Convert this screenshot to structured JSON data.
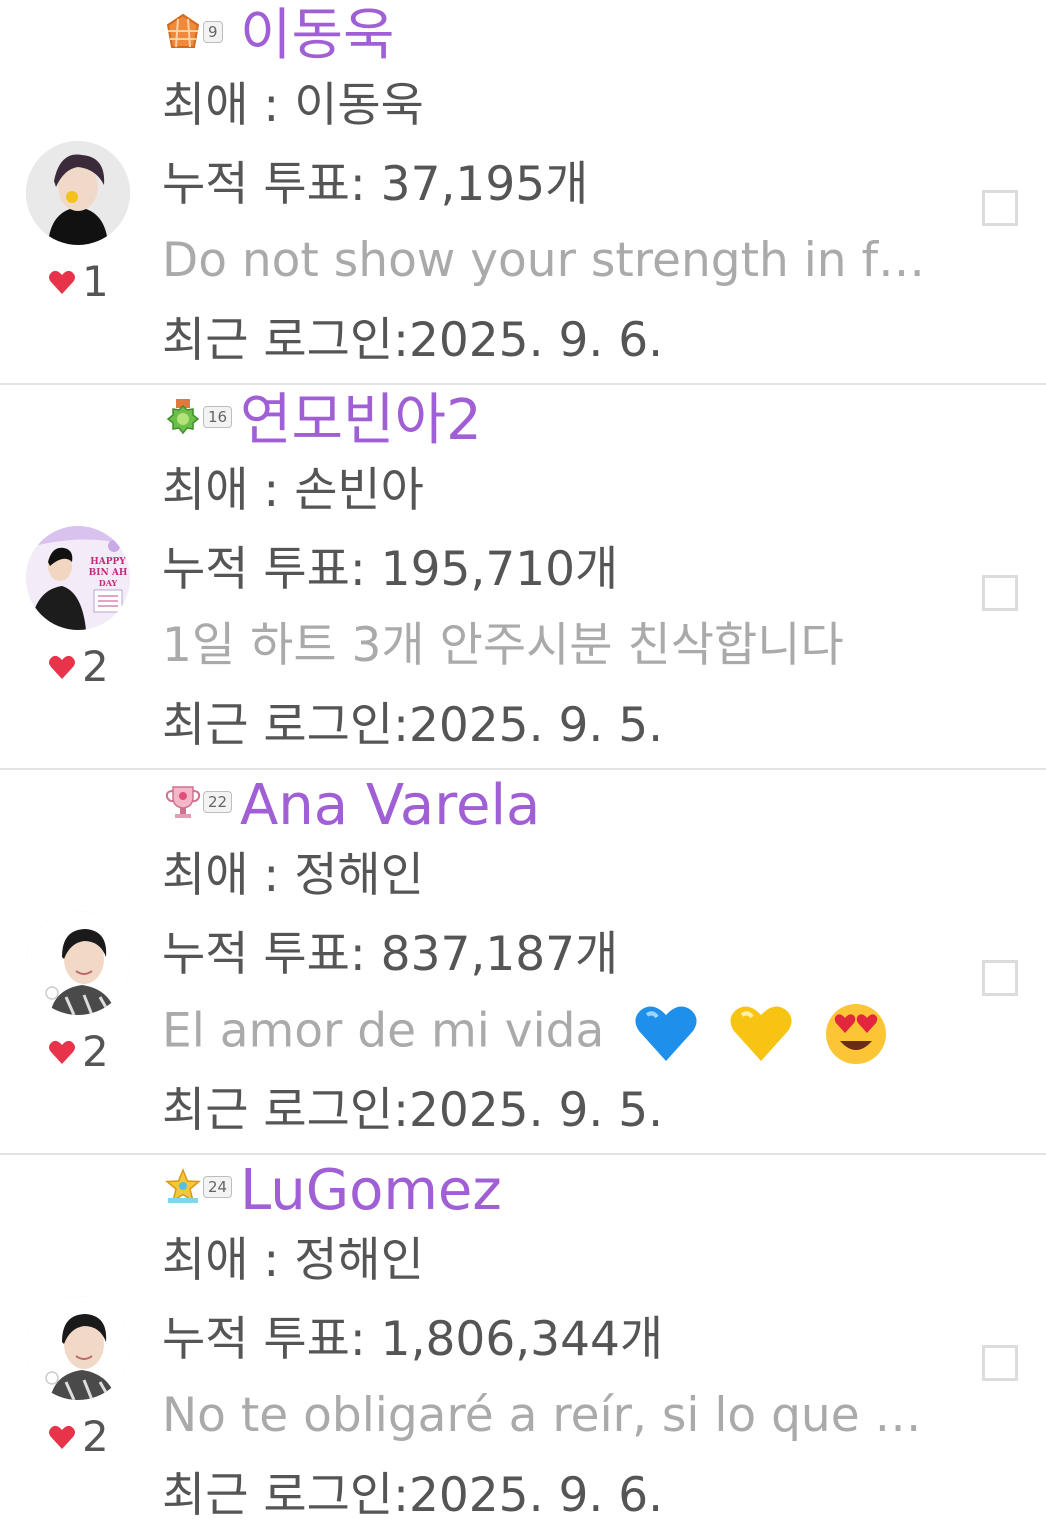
{
  "users": [
    {
      "nickname": "이동욱",
      "level": "9",
      "badge_icon": "orange-grid-badge-icon",
      "likes": "1",
      "favorite": "최애 : 이동욱",
      "votes": "누적 투표: 37,195개",
      "message": "Do not show your strength in f…",
      "last_login": "최근 로그인:2025. 9. 6."
    },
    {
      "nickname": "연모빈아2",
      "level": "16",
      "badge_icon": "green-medal-badge-icon",
      "likes": "2",
      "favorite": "최애 : 손빈아",
      "votes": "누적 투표: 195,710개",
      "message": "1일 하트 3개 안주시분 친삭합니다",
      "last_login": "최근 로그인:2025. 9. 5.",
      "avatar_text": [
        "HAPPY",
        "BIN AH",
        "DAY"
      ]
    },
    {
      "nickname": "Ana Varela",
      "level": "22",
      "badge_icon": "pink-trophy-badge-icon",
      "likes": "2",
      "favorite": "최애 : 정해인",
      "votes": "누적 투표: 837,187개",
      "message": "El amor de mi vida",
      "message_emojis": [
        "blue-heart-emoji",
        "yellow-heart-emoji",
        "heart-eyes-emoji"
      ],
      "last_login": "최근 로그인:2025. 9. 5."
    },
    {
      "nickname": "LuGomez",
      "level": "24",
      "badge_icon": "gold-star-badge-icon",
      "likes": "2",
      "favorite": "최애 : 정해인",
      "votes": "누적 투표: 1,806,344개",
      "message": "No te obligaré a reír, si lo que …",
      "last_login": "최근 로그인:2025. 9. 6."
    }
  ],
  "colors": {
    "nickname": "#a05fd5",
    "text": "#555555",
    "message": "#aaaaaa",
    "heart": "#e8344a",
    "divider": "#e3e3e3"
  }
}
